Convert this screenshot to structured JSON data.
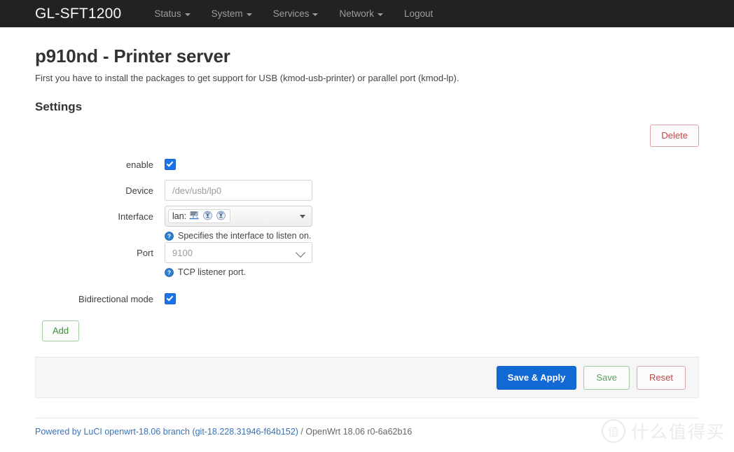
{
  "navbar": {
    "brand": "GL-SFT1200",
    "items": [
      {
        "label": "Status",
        "has_caret": true,
        "name": "nav-item-status"
      },
      {
        "label": "System",
        "has_caret": true,
        "name": "nav-item-system"
      },
      {
        "label": "Services",
        "has_caret": true,
        "name": "nav-item-services"
      },
      {
        "label": "Network",
        "has_caret": true,
        "name": "nav-item-network"
      },
      {
        "label": "Logout",
        "has_caret": false,
        "name": "nav-item-logout"
      }
    ]
  },
  "page": {
    "title": "p910nd - Printer server",
    "description": "First you have to install the packages to get support for USB (kmod-usb-printer) or parallel port (kmod-lp).",
    "section_title": "Settings"
  },
  "delete_button": {
    "label": "Delete"
  },
  "form": {
    "enable": {
      "label": "enable",
      "checked": true
    },
    "device": {
      "label": "Device",
      "value": "",
      "placeholder": "/dev/usb/lp0"
    },
    "interface": {
      "label": "Interface",
      "selected": "lan:",
      "icons": [
        "ethernet-icon",
        "wifi-icon",
        "wifi-icon"
      ],
      "hint": "Specifies the interface to listen on.",
      "hint_icon": "help-icon"
    },
    "port": {
      "label": "Port",
      "value": "9100",
      "hint": "TCP listener port.",
      "hint_icon": "help-icon"
    },
    "bidirectional": {
      "label": "Bidirectional mode",
      "checked": true
    },
    "add_button": {
      "label": "Add"
    }
  },
  "actions": {
    "apply_label": "Save & Apply",
    "save_label": "Save",
    "reset_label": "Reset"
  },
  "footer": {
    "link_text": "Powered by LuCI openwrt-18.06 branch (git-18.228.31946-f64b152)",
    "suffix_text": " / OpenWrt 18.06 r0-6a62b16"
  },
  "watermark": {
    "badge": "值",
    "text": "什么值得买"
  },
  "colors": {
    "navbar_bg": "#222222",
    "accent_blue": "#1169d3",
    "checkbox_blue": "#1a73e8",
    "danger_red": "#b94a48",
    "success_green": "#3e8f3e",
    "link_blue": "#3a72b8",
    "panel_bg": "#f6f6f6"
  }
}
